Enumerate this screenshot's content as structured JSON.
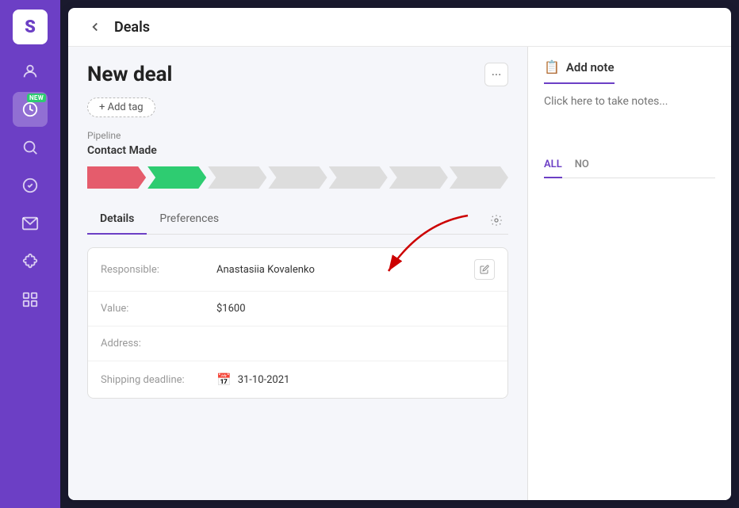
{
  "app": {
    "logo": "S"
  },
  "sidebar": {
    "items": [
      {
        "id": "person",
        "label": "Contacts",
        "active": false
      },
      {
        "id": "deals",
        "label": "Deals",
        "active": true,
        "badge": "NEW"
      },
      {
        "id": "search",
        "label": "Search",
        "active": false
      },
      {
        "id": "tasks",
        "label": "Tasks",
        "active": false
      },
      {
        "id": "mail",
        "label": "Mail",
        "active": false
      },
      {
        "id": "integrations",
        "label": "Integrations",
        "active": false
      },
      {
        "id": "dashboard",
        "label": "Dashboard",
        "active": false
      }
    ]
  },
  "topbar": {
    "back_label": "←",
    "title": "Deals"
  },
  "deal": {
    "title": "New deal",
    "more_label": "···",
    "add_tag_label": "+ Add tag",
    "pipeline_label": "Pipeline",
    "pipeline_stage": "Contact Made",
    "pipeline_steps": [
      {
        "color": "#e55c6c",
        "active": true
      },
      {
        "color": "#2ecc71",
        "active": true
      },
      {
        "color": "#ddd",
        "active": false
      },
      {
        "color": "#ddd",
        "active": false
      },
      {
        "color": "#ddd",
        "active": false
      },
      {
        "color": "#ddd",
        "active": false
      },
      {
        "color": "#ddd",
        "active": false
      }
    ]
  },
  "tabs": {
    "items": [
      {
        "id": "details",
        "label": "Details",
        "active": true
      },
      {
        "id": "preferences",
        "label": "Preferences",
        "active": false
      }
    ]
  },
  "details": {
    "rows": [
      {
        "label": "Responsible:",
        "value": "Anastasiia Kovalenko",
        "editable": true
      },
      {
        "label": "Value:",
        "value": "$1600",
        "editable": false
      },
      {
        "label": "Address:",
        "value": "",
        "editable": false
      },
      {
        "label": "Shipping deadline:",
        "value": "31-10-2021",
        "editable": false,
        "has_calendar": true
      }
    ]
  },
  "note_panel": {
    "add_note_label": "Add note",
    "note_placeholder": "Click here to take notes...",
    "filter_tabs": [
      {
        "label": "ALL",
        "active": true
      },
      {
        "label": "NO",
        "active": false
      }
    ]
  }
}
